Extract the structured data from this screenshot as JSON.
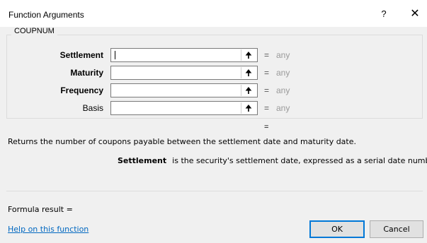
{
  "window": {
    "title": "Function Arguments",
    "help_label": "?",
    "close_label": "✕"
  },
  "function": {
    "name": "COUPNUM",
    "args": [
      {
        "label": "Settlement",
        "value": "",
        "result": "any",
        "bold": true
      },
      {
        "label": "Maturity",
        "value": "",
        "result": "any",
        "bold": true
      },
      {
        "label": "Frequency",
        "value": "",
        "result": "any",
        "bold": true
      },
      {
        "label": "Basis",
        "value": "",
        "result": "any",
        "bold": false
      }
    ],
    "eq_sign": "=",
    "result_eq": "=",
    "description": "Returns the number of coupons payable between the settlement date and maturity date.",
    "arg_desc_name": "Settlement",
    "arg_desc_text": "is the security's settlement date, expressed as a serial date number."
  },
  "footer": {
    "formula_result": "Formula result =",
    "help_link": "Help on this function",
    "ok_label": "OK",
    "cancel_label": "Cancel"
  },
  "icons": {
    "collapse": "collapse-dialog-icon"
  }
}
